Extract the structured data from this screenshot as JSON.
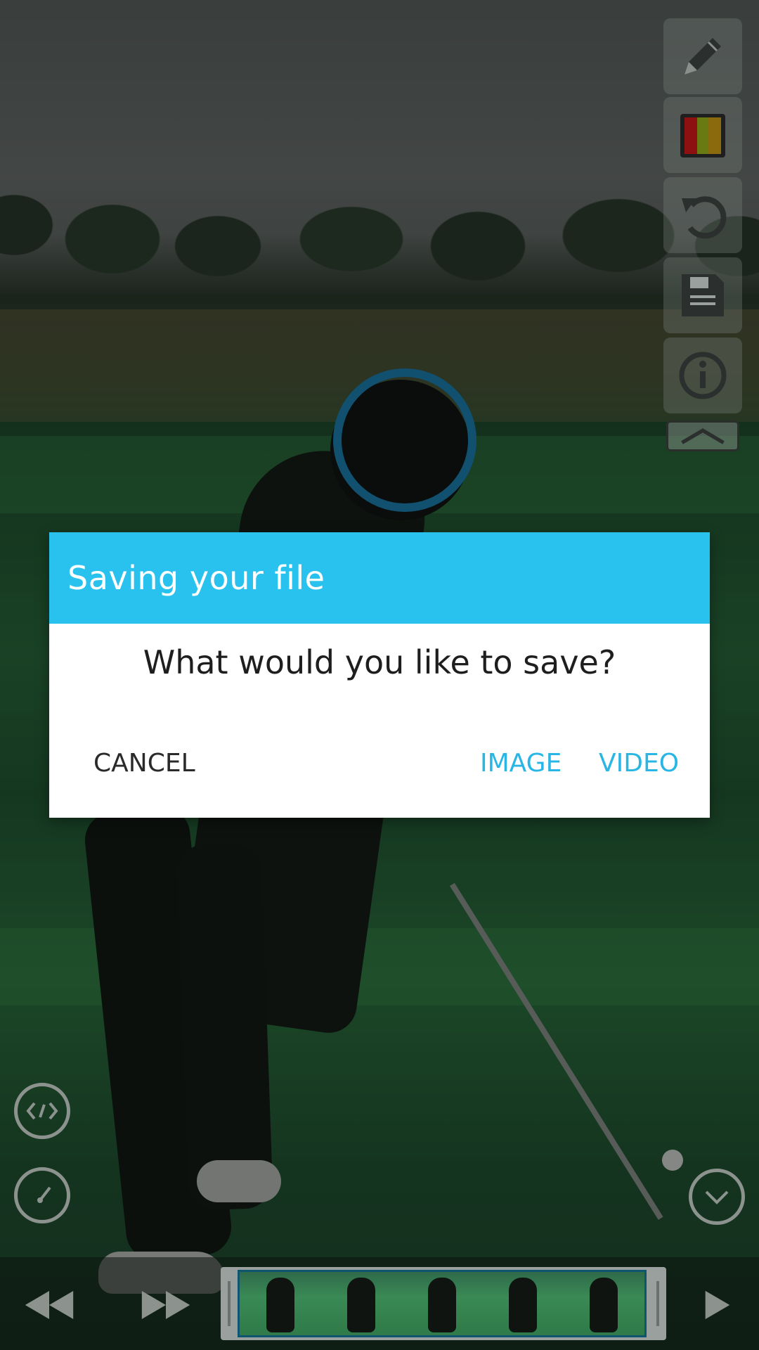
{
  "dialog": {
    "title": "Saving your file",
    "message": "What would you like to save?",
    "cancel_label": "CANCEL",
    "image_label": "IMAGE",
    "video_label": "VIDEO"
  },
  "toolbar": {
    "items": [
      "pencil-icon",
      "color-palette-icon",
      "undo-icon",
      "save-icon",
      "info-icon",
      "collapse-up-icon"
    ]
  },
  "left_controls": [
    "code-compare-icon",
    "speed-gauge-icon"
  ],
  "right_controls": [
    "expand-down-icon"
  ],
  "bottom_bar": {
    "items": [
      "rewind-icon",
      "fast-forward-icon",
      "frame-strip",
      "play-icon"
    ],
    "frame_count": 5
  },
  "colors": {
    "accent": "#29c2ef",
    "button_text": "#29b6e4",
    "ring": "#11506f"
  }
}
